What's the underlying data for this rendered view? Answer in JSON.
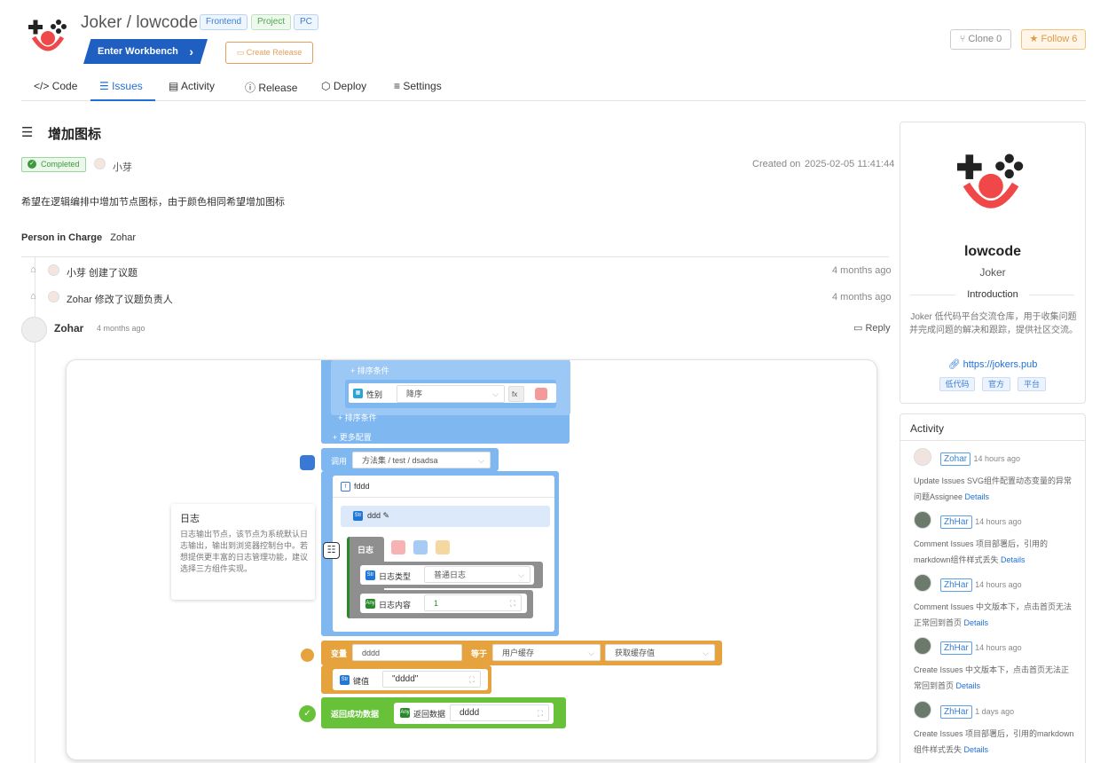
{
  "header": {
    "owner": "Joker",
    "repo": "lowcode",
    "tags": [
      "Frontend",
      "Project",
      "PC"
    ],
    "enter_workbench": "Enter Workbench",
    "create_release": "Create Release",
    "clone": "Clone 0",
    "follow": "Follow 6"
  },
  "nav": [
    "Code",
    "Issues",
    "Activity",
    "Release",
    "Deploy",
    "Settings"
  ],
  "issue": {
    "title": "增加图标",
    "status": "Completed",
    "author": "小芽",
    "created_label": "Created on",
    "created_at": "2025-02-05 11:41:44",
    "description": "希望在逻辑编排中增加节点图标，由于颜色相同希望增加图标",
    "person_in_charge_label": "Person in Charge",
    "person_in_charge": "Zohar",
    "timeline": [
      {
        "text": "小芽 创建了议题",
        "ago": "4 months ago"
      },
      {
        "text": "Zohar 修改了议题负责人",
        "ago": "4 months ago"
      }
    ],
    "comment": {
      "author": "Zohar",
      "ago": "4 months ago",
      "reply": "Reply"
    }
  },
  "flow": {
    "sort_condition": "+ 排序条件",
    "gender_label": "性别",
    "gender_value": "降序",
    "fx": "fx",
    "sort_condition2": "+ 排序条件",
    "more_config": "+ 更多配置",
    "call_label": "调用",
    "call_value": "方法集 / test / dsadsa",
    "fddd": "fddd",
    "ddd": "ddd",
    "log_title": "日志",
    "log_type_label": "日志类型",
    "log_type_value": "普通日志",
    "log_content_label": "日志内容",
    "log_content_value": "1",
    "var_label": "变量",
    "var_value": "dddd",
    "equals": "等于",
    "user_cache": "用户缓存",
    "get_cache": "获取缓存值",
    "key_label": "键值",
    "key_value": "\"dddd\"",
    "return_label": "返回成功数据",
    "return_data_label": "返回数据",
    "return_data_value": "dddd",
    "tooltip_title": "日志",
    "tooltip_body": "日志输出节点，该节点为系统默认日志输出，输出到浏览器控制台中。若想提供更丰富的日志管理功能，建议选择三方组件实现。"
  },
  "project_card": {
    "name": "lowcode",
    "owner": "Joker",
    "intro_label": "Introduction",
    "intro": "Joker 低代码平台交流仓库，用于收集问题并完成问题的解决和跟踪，提供社区交流。",
    "link": "https://jokers.pub",
    "tags": [
      "低代码",
      "官方",
      "平台"
    ]
  },
  "activity": {
    "title": "Activity",
    "items": [
      {
        "user": "Zohar",
        "ago": "14 hours ago",
        "text": "Update Issues  SVG组件配置动态变量的异常问题Assignee",
        "details": "Details"
      },
      {
        "user": "ZhHar",
        "ago": "14 hours ago",
        "text": "Comment Issues  项目部署后，引用的markdown组件样式丢失",
        "details": "Details"
      },
      {
        "user": "ZhHar",
        "ago": "14 hours ago",
        "text": "Comment Issues  中文版本下，点击首页无法正常回到首页",
        "details": "Details"
      },
      {
        "user": "ZhHar",
        "ago": "14 hours ago",
        "text": "Create Issues  中文版本下，点击首页无法正常回到首页",
        "details": "Details"
      },
      {
        "user": "ZhHar",
        "ago": "1 days ago",
        "text": "Create Issues  项目部署后，引用的markdown组件样式丢失",
        "details": "Details"
      }
    ]
  },
  "colors": {
    "primary": "#1f6fd8",
    "flow_blue": "#7fb7f0",
    "flow_grey": "#8f8f8f",
    "flow_orange": "#e6a23c",
    "flow_green": "#67c23a"
  }
}
